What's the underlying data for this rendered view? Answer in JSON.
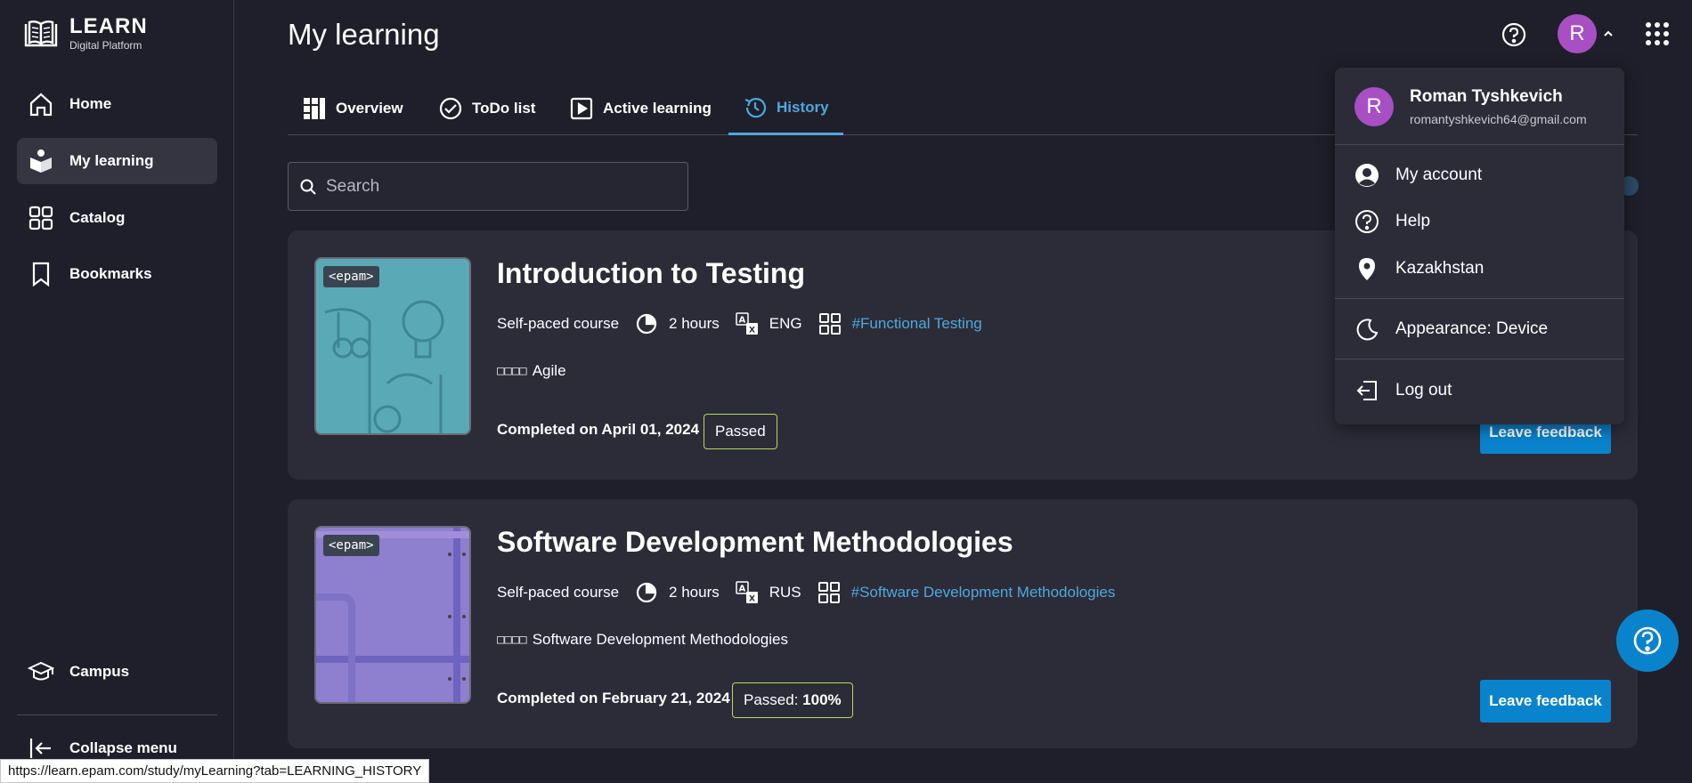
{
  "app": {
    "logo_title": "LEARN",
    "logo_subtitle": "Digital Platform"
  },
  "sidebar": {
    "items": [
      {
        "label": "Home",
        "icon": "home-icon"
      },
      {
        "label": "My learning",
        "icon": "my-learning-icon",
        "active": true
      },
      {
        "label": "Catalog",
        "icon": "catalog-icon"
      },
      {
        "label": "Bookmarks",
        "icon": "bookmark-icon"
      }
    ],
    "campus_label": "Campus",
    "collapse_label": "Collapse menu"
  },
  "header": {
    "title": "My learning",
    "avatar_initial": "R"
  },
  "tabs": [
    {
      "label": "Overview",
      "icon": "overview-icon"
    },
    {
      "label": "ToDo list",
      "icon": "check-circle-icon"
    },
    {
      "label": "Active learning",
      "icon": "play-icon"
    },
    {
      "label": "History",
      "icon": "history-icon",
      "active": true
    }
  ],
  "search": {
    "placeholder": "Search",
    "value": ""
  },
  "courses": [
    {
      "title": "Introduction to Testing",
      "type": "Self-paced course",
      "duration": "2 hours",
      "language": "ENG",
      "tag": "#Functional Testing",
      "skill_boxes": "□□□□",
      "skill": "Agile",
      "completed": "Completed on April 01, 2024",
      "status": "Passed",
      "status_score": "",
      "feedback_label": "Leave feedback",
      "badge": "<epam>",
      "thumb_color": "#5aa9b6"
    },
    {
      "title": "Software Development Methodologies",
      "type": "Self-paced course",
      "duration": "2 hours",
      "language": "RUS",
      "tag": "#Software Development Methodologies",
      "skill_boxes": "□□□□",
      "skill": "Software Development Methodologies",
      "completed": "Completed on February 21, 2024",
      "status": "Passed: ",
      "status_score": "100%",
      "feedback_label": "Leave feedback",
      "badge": "<epam>",
      "thumb_color": "#8e7fcf"
    }
  ],
  "user_menu": {
    "name": "Roman Tyshkevich",
    "email": "romantyshkevich64@gmail.com",
    "initial": "R",
    "items": [
      {
        "label": "My account",
        "icon": "account-icon"
      },
      {
        "label": "Help",
        "icon": "help-icon"
      },
      {
        "label": "Kazakhstan",
        "icon": "location-icon"
      },
      {
        "label": "Appearance: Device",
        "icon": "moon-icon"
      },
      {
        "label": "Log out",
        "icon": "logout-icon"
      }
    ]
  },
  "status_url": "https://learn.epam.com/study/myLearning?tab=LEARNING_HISTORY",
  "colors": {
    "accent": "#4ea8dc",
    "button": "#0a83cd",
    "avatar": "#a84fc4",
    "badge_border": "#b9d85a"
  }
}
